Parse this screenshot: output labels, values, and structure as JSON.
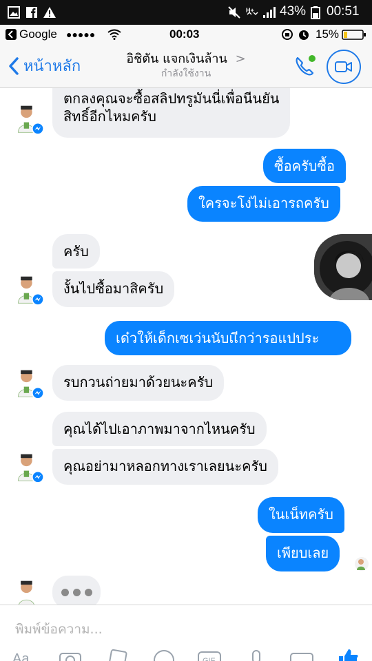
{
  "android_status": {
    "battery": "43%",
    "time": "00:51",
    "icons": [
      "gallery-icon",
      "facebook-icon",
      "warning-icon",
      "mute-icon",
      "hplus-icon",
      "signal-icon",
      "battery-icon"
    ]
  },
  "ios_status": {
    "carrier": "Google",
    "signal": "●●●●●",
    "time": "00:03",
    "battery": "15%"
  },
  "header": {
    "back_label": "หน้าหลัก",
    "title": "อิชิตัน แจกเงินล้าน",
    "title_chevron": ">",
    "subtitle": "กำลังใช้งาน"
  },
  "messages": [
    {
      "side": "in",
      "text_line1": "ตกลงคุณจะซื้อสลิปทรูมันนี่เพื่อนีนยัน",
      "text_line2": "สิทธิ์อีกไหมครับ"
    },
    {
      "side": "out",
      "text": "ซื้อครับซื้อ"
    },
    {
      "side": "out",
      "text": "ใครจะโง่ไม่เอารถครับ"
    },
    {
      "side": "in",
      "text": "ครับ"
    },
    {
      "side": "in",
      "text": "งั้นไปซื้อมาสิครับ"
    },
    {
      "side": "out",
      "text": "เด๋วให้เด็กเซเว่นนับเเีกว่ารอแปประ"
    },
    {
      "side": "in",
      "text": "รบกวนถ่ายมาด้วยนะครับ"
    },
    {
      "side": "in",
      "text": "คุณได้ไปเอาภาพมาจากไหนครับ"
    },
    {
      "side": "in",
      "text": "คุณอย่ามาหลอกทางเราเลยนะครับ"
    },
    {
      "side": "out",
      "text": "ในเน็ทครับ"
    },
    {
      "side": "out",
      "text": "เพียบเลย"
    }
  ],
  "composer": {
    "placeholder": "พิมพ์ข้อความ..."
  },
  "colors": {
    "accent": "#0a84ff",
    "incoming_bubble": "#eeeff2",
    "header_bg": "#f7f7f7"
  }
}
